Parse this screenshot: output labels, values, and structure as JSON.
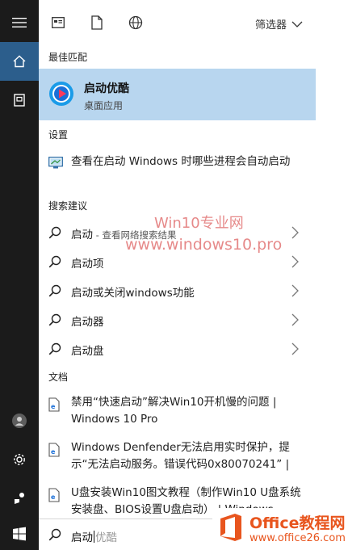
{
  "topbar": {
    "filter_label": "筛选器"
  },
  "sections": {
    "best_match": "最佳匹配",
    "settings": "设置",
    "search_suggestions": "搜索建议",
    "documents": "文档"
  },
  "best_match": {
    "title": "启动优酷",
    "subtitle": "桌面应用",
    "icon": "youku-logo-icon"
  },
  "setting_item": {
    "text": "查看在启动 Windows 时哪些进程会自动启动"
  },
  "suggestions": [
    {
      "text": "启动",
      "hint": " - 查看网络搜索结果"
    },
    {
      "text": "启动项",
      "hint": ""
    },
    {
      "text": "启动或关闭windows功能",
      "hint": ""
    },
    {
      "text": "启动器",
      "hint": ""
    },
    {
      "text": "启动盘",
      "hint": ""
    }
  ],
  "documents": [
    {
      "text": "禁用“快速启动”解决Win10开机慢的问题 | Windows 10 Pro"
    },
    {
      "text": "Windows Denfender无法启用实时保护，提示“无法启动服务。错误代码0x80070241” |"
    },
    {
      "text": "U盘安装Win10图文教程（制作Win10 U盘系统安装盘、BIOS设置U盘启动） | Windows"
    }
  ],
  "search_box": {
    "typed": "启动",
    "suggestion_ghost": "优酷"
  },
  "watermark": {
    "line1": "Win10专业网",
    "line2": "www.windows10.pro"
  },
  "corner_badge": {
    "line1": "Office教程网",
    "line2": "www.office26.com"
  },
  "colors": {
    "rail_bg": "#1b1b1b",
    "rail_active": "#2c5e8c",
    "best_match_bg": "#b8d6ef",
    "accent": "#0078d7",
    "badge_orange": "#e8551e"
  }
}
